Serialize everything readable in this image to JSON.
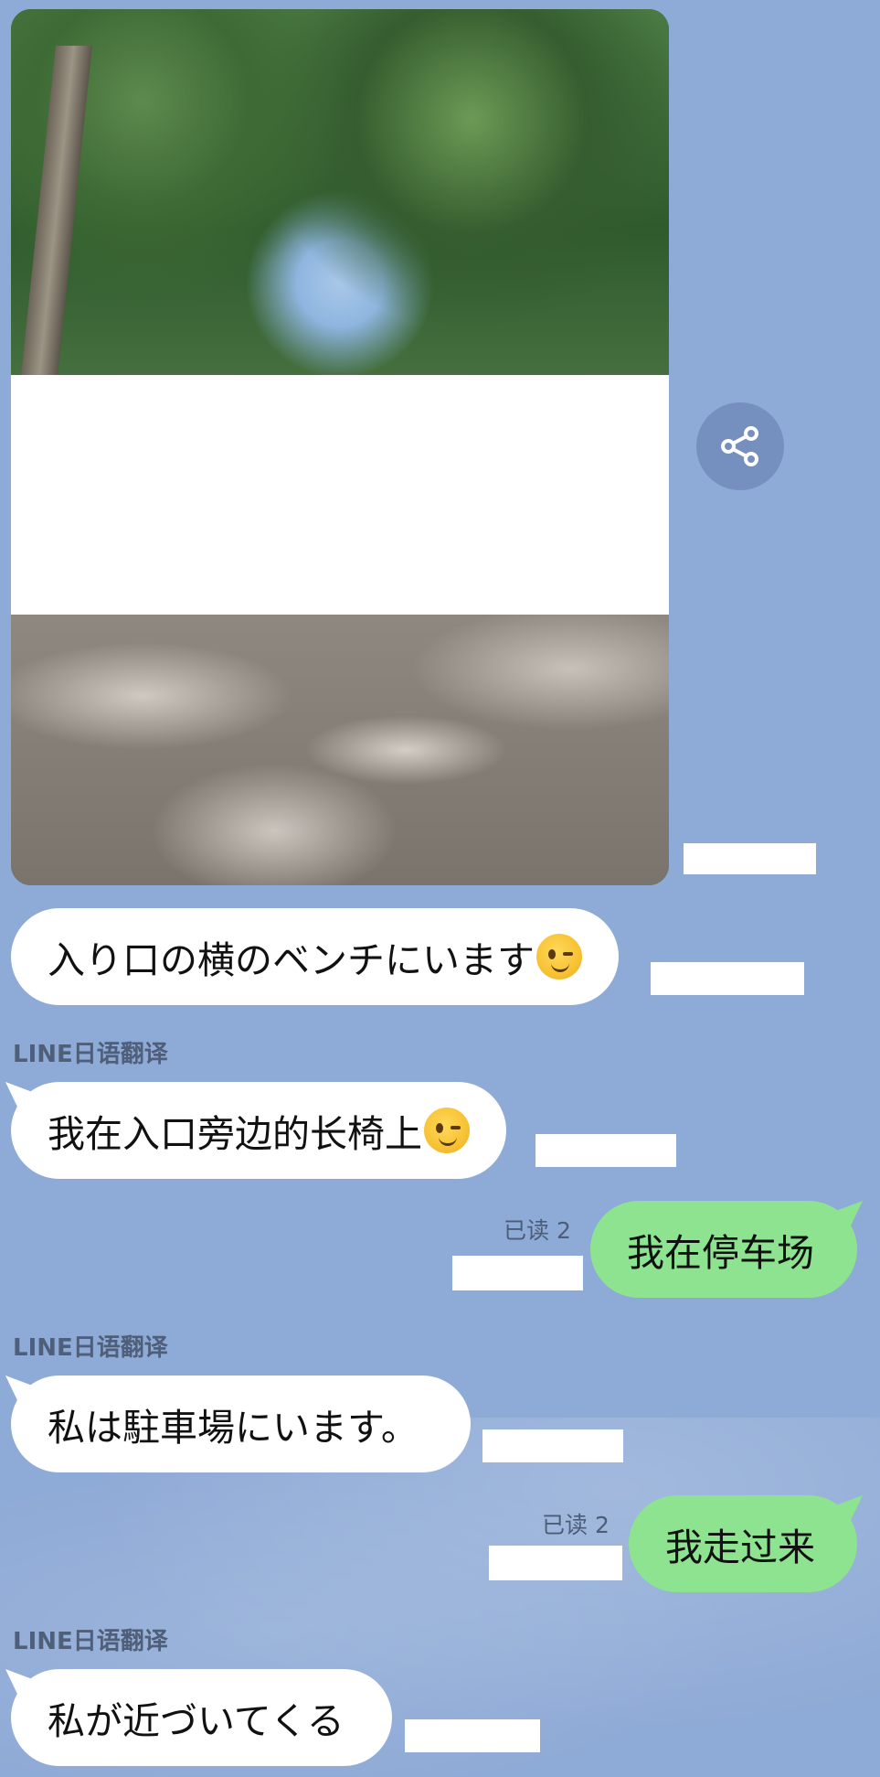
{
  "messages": {
    "m1": {
      "text": "入り口の横のベンチにいます"
    },
    "m2": {
      "sender": "LINE日语翻译",
      "text": "我在入口旁边的长椅上"
    },
    "m3": {
      "read": "已读 2",
      "text": "我在停车场"
    },
    "m4": {
      "sender": "LINE日语翻译",
      "text": "私は駐車場にいます。"
    },
    "m5": {
      "read": "已读 2",
      "text": "我走过来"
    },
    "m6": {
      "sender": "LINE日语翻译",
      "text": "私が近づいてくる"
    }
  },
  "icons": {
    "share": "share-icon",
    "emoji": "winking-face-emoji"
  },
  "colors": {
    "background": "#8eaad6",
    "incoming_bubble": "#ffffff",
    "outgoing_bubble": "#8de38f",
    "share_button": "#7590bf"
  }
}
